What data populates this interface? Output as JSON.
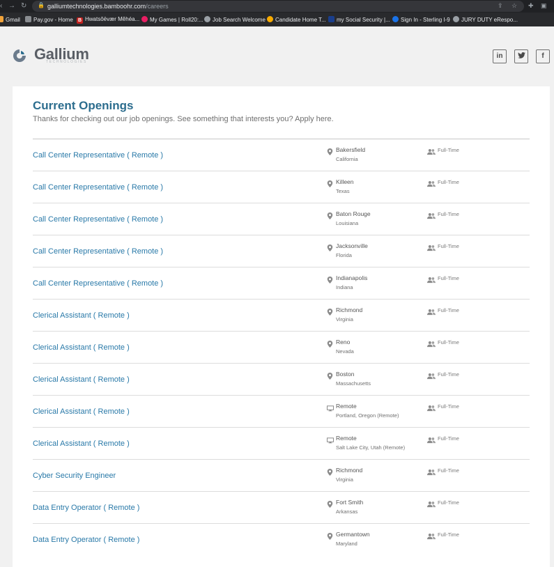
{
  "browser": {
    "url_host": "galliumtechnologies.bamboohr.com",
    "url_path": "/careers",
    "bookmarks": [
      {
        "label": "Gmail",
        "icon": "gmail-icon",
        "color": "#e37400"
      },
      {
        "label": "Pay.gov - Home",
        "icon": "paygov-icon",
        "color": "#5f6368"
      },
      {
        "label": "Hwatsôëvær Mêhéa...",
        "icon": "b-icon",
        "color": "#c5221f"
      },
      {
        "label": "My Games | Roll20:...",
        "icon": "roll20-icon",
        "color": "#e91e63"
      },
      {
        "label": "Job Search Welcome",
        "icon": "globe-icon",
        "color": "#9aa0a6"
      },
      {
        "label": "Candidate Home T...",
        "icon": "candidate-icon",
        "color": "#f9ab00"
      },
      {
        "label": "my Social Security |...",
        "icon": "ssa-icon",
        "color": "#1a3e8c"
      },
      {
        "label": "Sign In - Sterling I-9",
        "icon": "sterling-icon",
        "color": "#1a73e8"
      },
      {
        "label": "JURY DUTY eRespo...",
        "icon": "globe-icon",
        "color": "#9aa0a6"
      }
    ]
  },
  "brand": {
    "name": "Gallium",
    "sub": "TECHNOLOGIES",
    "accent": "#2c6d8e"
  },
  "social": [
    {
      "icon": "linkedin-icon",
      "glyph": "in"
    },
    {
      "icon": "twitter-icon",
      "glyph": "✦"
    },
    {
      "icon": "facebook-icon",
      "glyph": "f"
    }
  ],
  "page": {
    "title": "Current Openings",
    "subtitle": "Thanks for checking out our job openings. See something that interests you? Apply here."
  },
  "jobs": [
    {
      "title": "Call Center Representative ( Remote )",
      "location_icon": "map-pin-icon",
      "city": "Bakersfield",
      "state": "California",
      "type": "Full-Time"
    },
    {
      "title": "Call Center Representative ( Remote )",
      "location_icon": "map-pin-icon",
      "city": "Killeen",
      "state": "Texas",
      "type": "Full-Time"
    },
    {
      "title": "Call Center Representative ( Remote )",
      "location_icon": "map-pin-icon",
      "city": "Baton Rouge",
      "state": "Louisiana",
      "type": "Full-Time"
    },
    {
      "title": "Call Center Representative ( Remote )",
      "location_icon": "map-pin-icon",
      "city": "Jacksonville",
      "state": "Florida",
      "type": "Full-Time"
    },
    {
      "title": "Call Center Representative ( Remote )",
      "location_icon": "map-pin-icon",
      "city": "Indianapolis",
      "state": "Indiana",
      "type": "Full-Time"
    },
    {
      "title": "Clerical Assistant ( Remote )",
      "location_icon": "map-pin-icon",
      "city": "Richmond",
      "state": "Virginia",
      "type": "Full-Time"
    },
    {
      "title": "Clerical Assistant ( Remote )",
      "location_icon": "map-pin-icon",
      "city": "Reno",
      "state": "Nevada",
      "type": "Full-Time"
    },
    {
      "title": "Clerical Assistant ( Remote )",
      "location_icon": "map-pin-icon",
      "city": "Boston",
      "state": "Massachusetts",
      "type": "Full-Time"
    },
    {
      "title": "Clerical Assistant ( Remote )",
      "location_icon": "monitor-icon",
      "city": "Remote",
      "state": "Portland, Oregon (Remote)",
      "type": "Full-Time"
    },
    {
      "title": "Clerical Assistant ( Remote )",
      "location_icon": "monitor-icon",
      "city": "Remote",
      "state": "Salt Lake City, Utah (Remote)",
      "type": "Full-Time"
    },
    {
      "title": "Cyber Security Engineer",
      "location_icon": "map-pin-icon",
      "city": "Richmond",
      "state": "Virginia",
      "type": "Full-Time"
    },
    {
      "title": "Data Entry Operator ( Remote )",
      "location_icon": "map-pin-icon",
      "city": "Fort Smith",
      "state": "Arkansas",
      "type": "Full-Time"
    },
    {
      "title": "Data Entry Operator ( Remote )",
      "location_icon": "map-pin-icon",
      "city": "Germantown",
      "state": "Maryland",
      "type": "Full-Time"
    }
  ]
}
